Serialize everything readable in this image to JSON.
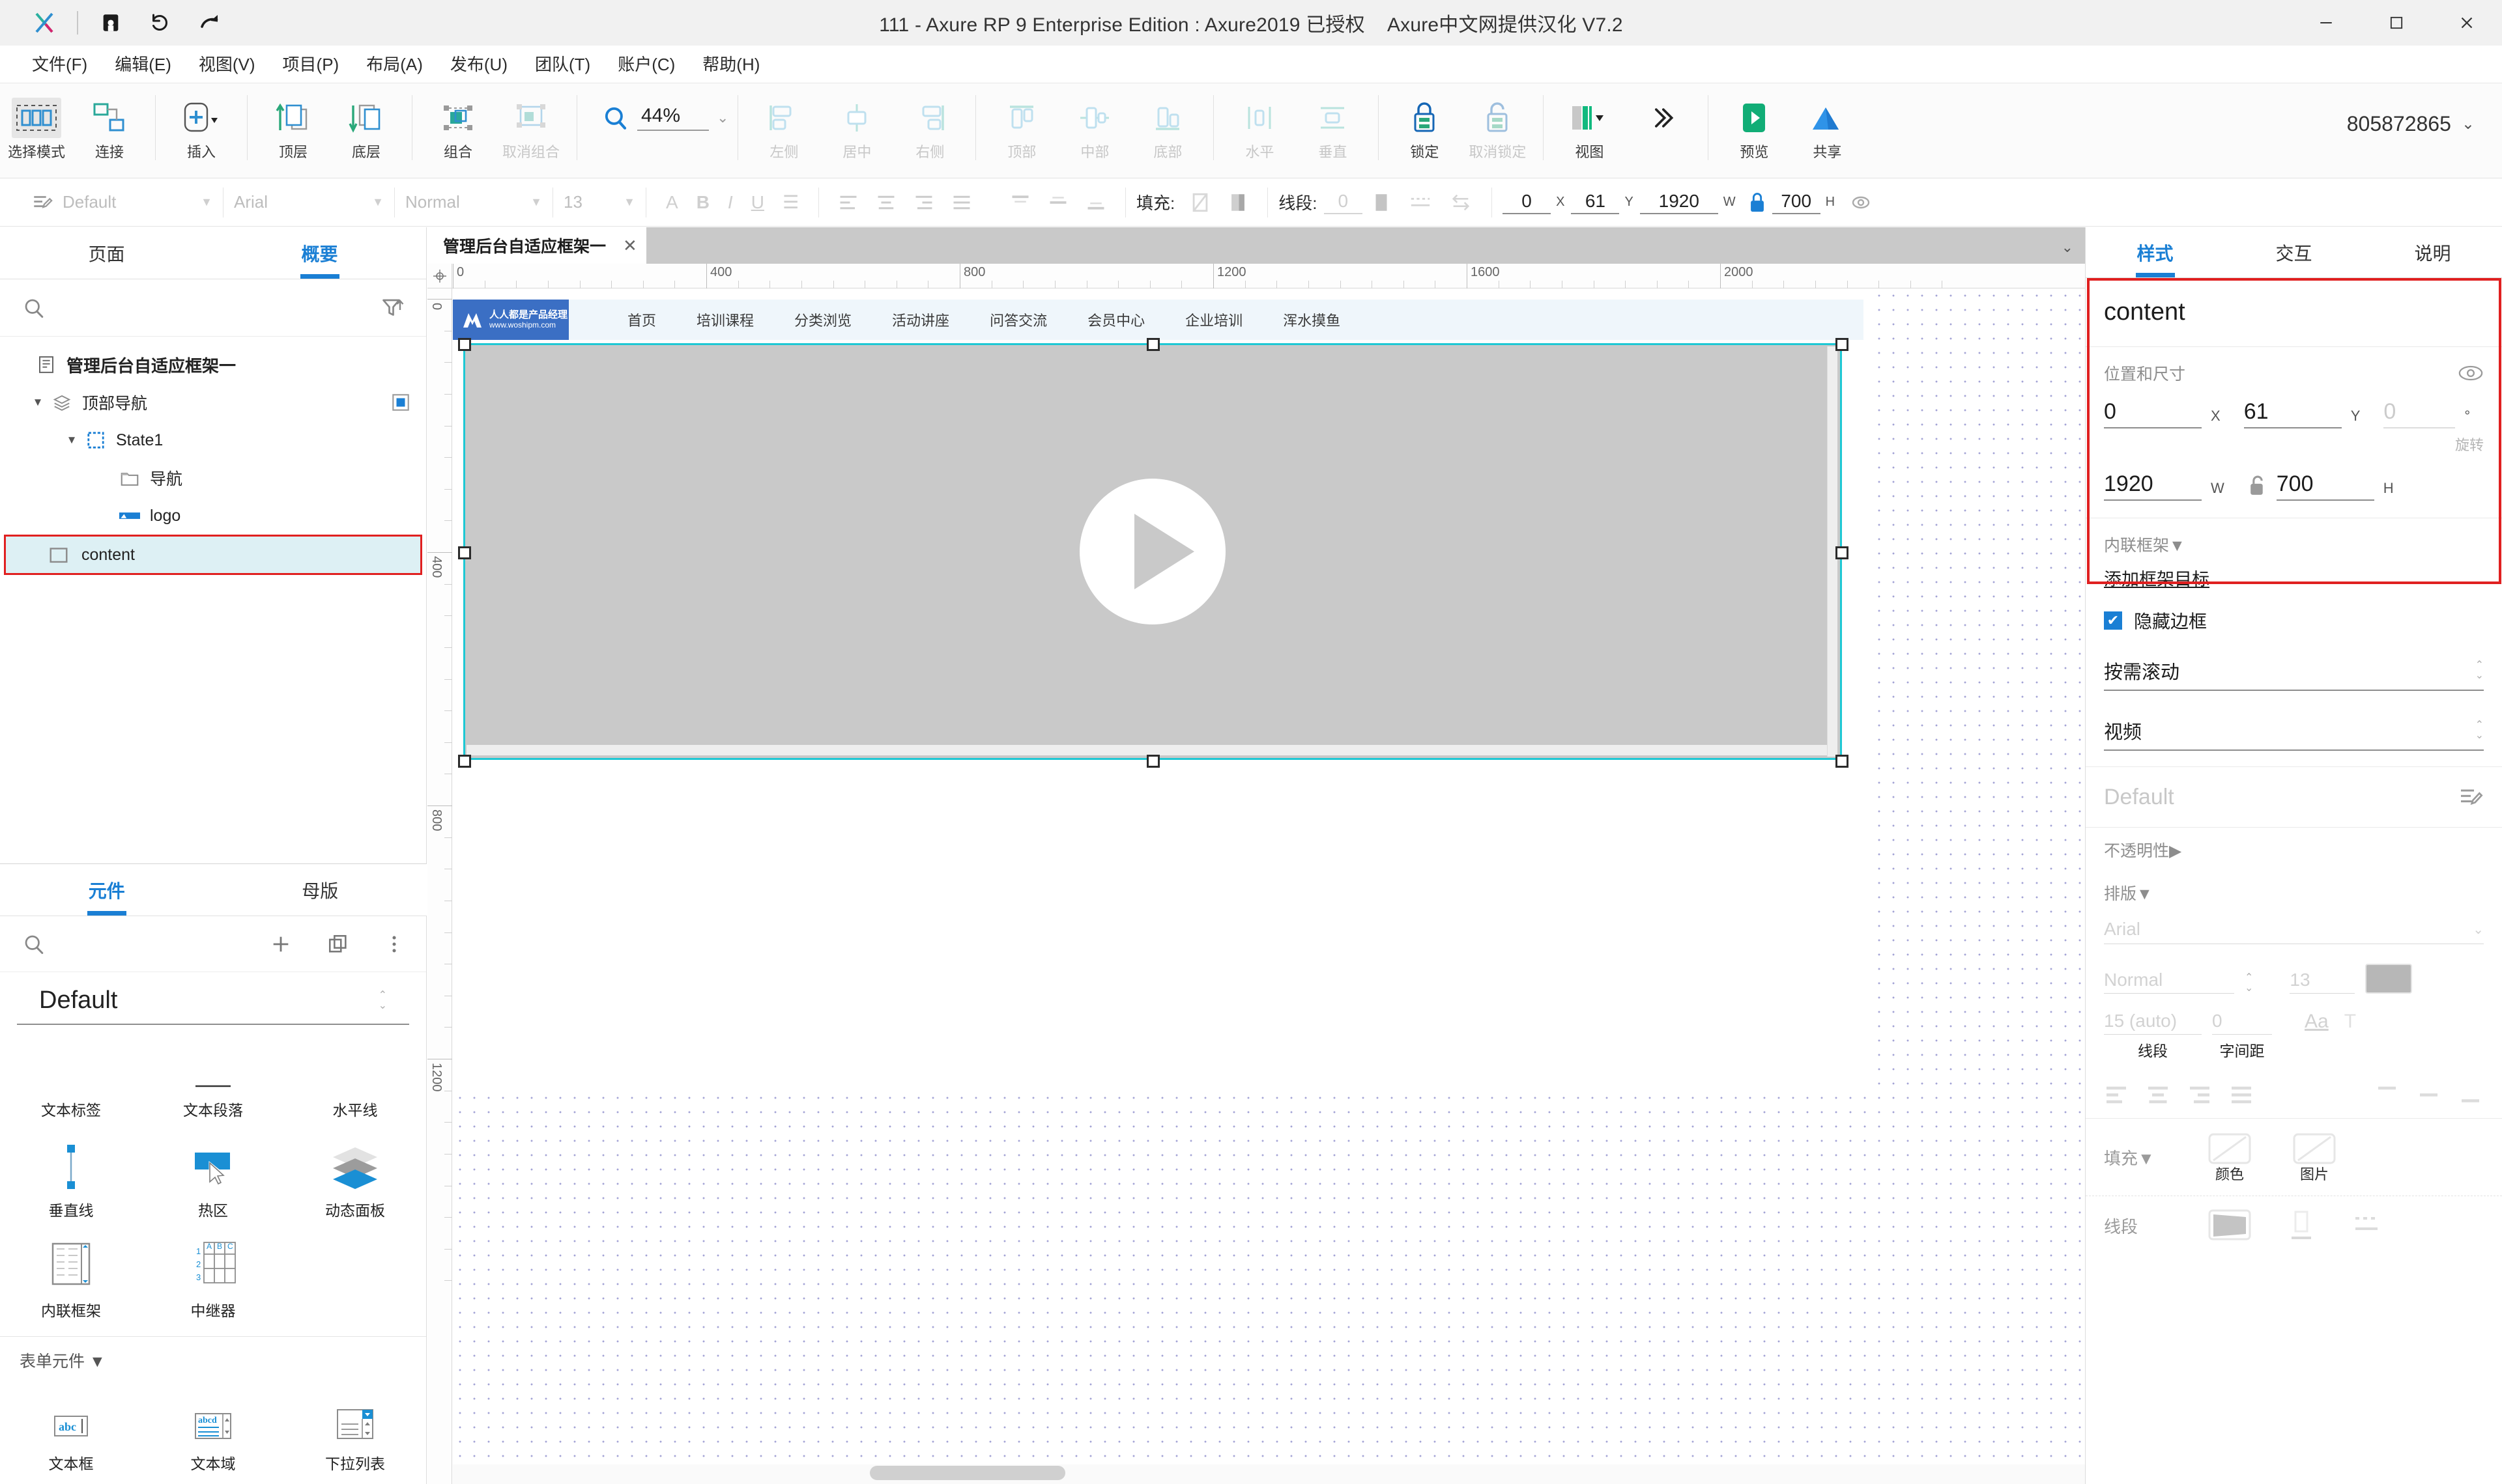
{
  "titlebar": {
    "app_title": "111 - Axure RP 9 Enterprise Edition : Axure2019 已授权    Axure中文网提供汉化 V7.2",
    "icons": [
      "save-icon",
      "undo-icon",
      "redo-icon"
    ],
    "window_controls": [
      "minimize",
      "maximize",
      "close"
    ]
  },
  "menubar": {
    "items": [
      {
        "label": "文件(F)"
      },
      {
        "label": "编辑(E)"
      },
      {
        "label": "视图(V)"
      },
      {
        "label": "项目(P)"
      },
      {
        "label": "布局(A)"
      },
      {
        "label": "发布(U)"
      },
      {
        "label": "团队(T)"
      },
      {
        "label": "账户(C)"
      },
      {
        "label": "帮助(H)"
      }
    ]
  },
  "toolbar": {
    "groups": [
      {
        "buttons": [
          {
            "label": "选择模式",
            "icon": "select-mode-icon",
            "disabled": false,
            "selected": true
          },
          {
            "label": "连接",
            "icon": "connect-icon",
            "disabled": false
          }
        ]
      },
      {
        "buttons": [
          {
            "label": "插入",
            "icon": "insert-plus-icon",
            "disabled": false
          }
        ]
      },
      {
        "buttons": [
          {
            "label": "顶层",
            "icon": "bring-front-icon",
            "disabled": false
          },
          {
            "label": "底层",
            "icon": "send-back-icon",
            "disabled": false
          }
        ]
      },
      {
        "buttons": [
          {
            "label": "组合",
            "icon": "group-icon",
            "disabled": false
          },
          {
            "label": "取消组合",
            "icon": "ungroup-icon",
            "disabled": true
          }
        ]
      },
      {
        "buttons": [
          {
            "label": "左侧",
            "icon": "align-left-icon",
            "disabled": true
          },
          {
            "label": "居中",
            "icon": "align-center-icon",
            "disabled": true
          },
          {
            "label": "右侧",
            "icon": "align-right-icon",
            "disabled": true
          }
        ]
      },
      {
        "buttons": [
          {
            "label": "顶部",
            "icon": "align-top-icon",
            "disabled": true
          },
          {
            "label": "中部",
            "icon": "align-middle-icon",
            "disabled": true
          },
          {
            "label": "底部",
            "icon": "align-bottom-icon",
            "disabled": true
          }
        ]
      },
      {
        "buttons": [
          {
            "label": "水平",
            "icon": "distribute-horizontal-icon",
            "disabled": true
          },
          {
            "label": "垂直",
            "icon": "distribute-vertical-icon",
            "disabled": true
          }
        ]
      },
      {
        "buttons": [
          {
            "label": "锁定",
            "icon": "lock-icon",
            "disabled": false
          },
          {
            "label": "取消锁定",
            "icon": "unlock-icon",
            "disabled": true
          }
        ]
      },
      {
        "buttons": [
          {
            "label": "视图",
            "icon": "view-panels-icon",
            "disabled": false
          }
        ]
      },
      {
        "buttons": [
          {
            "label": "预览",
            "icon": "preview-play-icon",
            "disabled": false
          },
          {
            "label": "共享",
            "icon": "share-cloud-icon",
            "disabled": false
          }
        ]
      }
    ],
    "zoom_value": "44%",
    "zoom_icon": "magnifier-icon",
    "overflow_icon": "chevron-double-right-icon",
    "account": "805872865",
    "account_caret": "⌄"
  },
  "formatbar": {
    "style_icon": "text-style-icon",
    "style_preset": "Default",
    "font_family": "Arial",
    "font_weight": "Normal",
    "font_size": "13",
    "text_icons": [
      "font-color-icon",
      "bold-icon",
      "italic-icon",
      "underline-icon",
      "list-icon"
    ],
    "align_icons": [
      "align-left-icon",
      "align-center-icon",
      "align-right-icon",
      "align-justify-icon",
      "valign-top-icon",
      "valign-middle-icon",
      "valign-bottom-icon"
    ],
    "fill_label": "填充:",
    "fill_icons": [
      "no-fill-icon",
      "fill-color-icon"
    ],
    "line_label": "线段:",
    "line_value": "0",
    "line_icons": [
      "line-color-icon",
      "line-style-icon",
      "arrow-style-icon"
    ],
    "geometry": {
      "x_value": "0",
      "x_label": "X",
      "y_value": "61",
      "y_label": "Y",
      "w_value": "1920",
      "w_label": "W",
      "lock_icon": "ratio-lock-icon",
      "h_value": "700",
      "h_label": "H",
      "visibility_icon": "hidden-eye-icon"
    }
  },
  "left_panel": {
    "tabs": [
      {
        "label": "页面",
        "active": false
      },
      {
        "label": "概要",
        "active": true
      }
    ],
    "search_icon": "search-icon",
    "filter_icon": "filter-sort-icon",
    "search_placeholder": "",
    "tree": [
      {
        "label": "管理后台自适应框架一",
        "icon": "page-icon",
        "depth": 0,
        "bold": true,
        "twist": "",
        "selected": false
      },
      {
        "label": "顶部导航",
        "icon": "dynamic-panel-icon",
        "depth": 1,
        "bold": false,
        "twist": "▼",
        "selected": false,
        "right_icon": "panel-state-icon"
      },
      {
        "label": "State1",
        "icon": "state-icon",
        "depth": 2,
        "bold": false,
        "twist": "▼",
        "selected": false
      },
      {
        "label": "导航",
        "icon": "folder-icon",
        "depth": 3,
        "bold": false,
        "twist": "",
        "selected": false
      },
      {
        "label": "logo",
        "icon": "image-icon",
        "depth": 3,
        "bold": false,
        "twist": "",
        "selected": false
      },
      {
        "label": "content",
        "icon": "rectangle-icon",
        "depth": 2,
        "bold": false,
        "twist": "",
        "selected": true
      }
    ]
  },
  "widget_panel": {
    "tabs": [
      {
        "label": "元件",
        "active": true
      },
      {
        "label": "母版",
        "active": false
      }
    ],
    "search_icon": "search-icon",
    "actions": [
      "add-library-icon",
      "duplicate-icon",
      "more-options-icon"
    ],
    "library_name": "Default",
    "library_stepper": "⌃⌄",
    "widgets_row1": [
      {
        "label": "文本标签",
        "icon": "text-label-icon"
      },
      {
        "label": "文本段落",
        "icon": "text-paragraph-icon"
      },
      {
        "label": "水平线",
        "icon": "horizontal-line-icon"
      }
    ],
    "widgets_row2": [
      {
        "label": "垂直线",
        "icon": "vertical-line-icon"
      },
      {
        "label": "热区",
        "icon": "hotspot-icon"
      },
      {
        "label": "动态面板",
        "icon": "dynamic-panel-icon"
      }
    ],
    "widgets_row3": [
      {
        "label": "内联框架",
        "icon": "inline-frame-icon"
      },
      {
        "label": "中继器",
        "icon": "repeater-icon"
      }
    ],
    "section_form": "表单元件",
    "section_caret": "▼",
    "widgets_form": [
      {
        "label": "文本框",
        "icon": "text-field-icon"
      },
      {
        "label": "文本域",
        "icon": "text-area-icon"
      },
      {
        "label": "下拉列表",
        "icon": "dropdown-icon"
      }
    ]
  },
  "canvas": {
    "page_tab": "管理后台自适应框架一",
    "page_tab_close": "✕",
    "tab_overflow_caret": "⌄",
    "origin_icon": "ruler-origin-icon",
    "ruler_h_labels": [
      "0",
      "400",
      "800",
      "1200",
      "1600",
      "2000"
    ],
    "ruler_v_labels": [
      "0",
      "400",
      "800",
      "1200"
    ],
    "site_logo": {
      "title": "人人都是产品经理",
      "url": "www.woshipm.com",
      "icon": "woshipm-logo-icon"
    },
    "site_nav": [
      "首页",
      "培训课程",
      "分类浏览",
      "活动讲座",
      "问答交流",
      "会员中心",
      "企业培训",
      "浑水摸鱼"
    ],
    "selected_widget": {
      "name": "content",
      "play_icon": "play-button-icon"
    }
  },
  "right_panel": {
    "tabs": [
      {
        "label": "样式",
        "active": true
      },
      {
        "label": "交互",
        "active": false
      },
      {
        "label": "说明",
        "active": false
      }
    ],
    "widget_name": "content",
    "position_section": {
      "title": "位置和尺寸",
      "eye_icon": "visibility-eye-icon",
      "x_value": "0",
      "x_label": "X",
      "y_value": "61",
      "y_label": "Y",
      "rotation_value": "0",
      "rotation_unit": "°",
      "rotation_label": "旋转",
      "w_value": "1920",
      "w_label": "W",
      "lock_icon": "aspect-lock-icon",
      "h_value": "700",
      "h_label": "H"
    },
    "frame_section": {
      "title": "内联框架",
      "caret": "▼",
      "add_target_link": "添加框架目标",
      "hide_border_checkbox": "隐藏边框",
      "hide_border_checked": true,
      "scroll_option": "按需滚动",
      "preview_option": "视频"
    },
    "style_preset": {
      "value": "Default",
      "edit_icon": "edit-style-icon"
    },
    "opacity_section": {
      "title": "不透明性",
      "caret": "▶"
    },
    "typography_section": {
      "title": "排版",
      "caret": "▼",
      "font_family": "Arial",
      "font_weight": "Normal",
      "font_size": "13",
      "color_swatch": "#b7b7b7",
      "line_height": "15 (auto)",
      "line_height_label": "线段",
      "letter_spacing": "0",
      "letter_spacing_label": "字间距",
      "case_icon": "text-case-icon",
      "decoration_icon": "text-decoration-icon",
      "align_icons": [
        "align-left-icon",
        "align-center-icon",
        "align-right-icon",
        "align-justify-icon"
      ],
      "valign_icons": [
        "valign-top-icon",
        "valign-middle-icon",
        "valign-bottom-icon"
      ]
    },
    "fill_section": {
      "title": "填充",
      "caret": "▼",
      "color_label": "颜色",
      "image_label": "图片",
      "color_icon": "fill-color-icon",
      "image_icon": "fill-image-icon"
    },
    "line_section": {
      "title": "线段",
      "icons": [
        "line-color-icon",
        "line-width-icon",
        "line-style-icon"
      ]
    }
  },
  "colors": {
    "accent_blue": "#1a7fd4",
    "selection_cyan": "#1ec8d4",
    "highlight_red": "#e02020",
    "selection_row_bg": "#ddf0f4",
    "widget_gray": "#c9c9c9",
    "site_nav_bg": "#eff6fb",
    "logo_blue": "#3b6fc4",
    "preview_green": "#13ad76",
    "share_blue": "#2f93e8"
  }
}
